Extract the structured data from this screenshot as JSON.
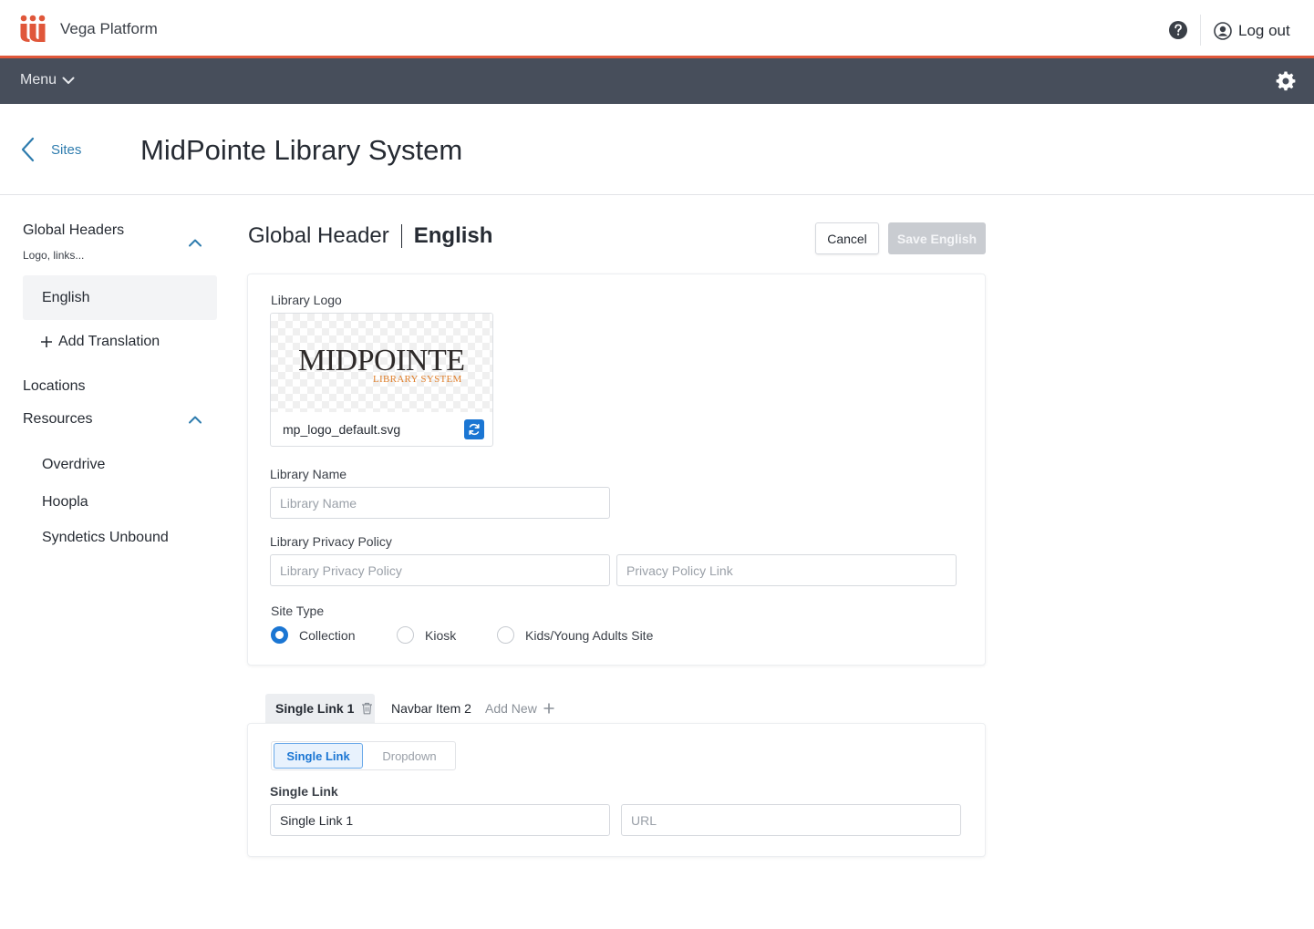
{
  "app": {
    "name": "Vega Platform",
    "logout_label": "Log out",
    "brand_color": "#e0573a"
  },
  "navbar": {
    "menu_label": "Menu"
  },
  "page": {
    "back_label": "Sites",
    "title": "MidPointe Library System"
  },
  "sidebar": {
    "global_headers": {
      "label": "Global Headers",
      "sub": "Logo, links..."
    },
    "active_item": "English",
    "add_translation": "Add Translation",
    "locations": "Locations",
    "resources": {
      "label": "Resources",
      "items": [
        "Overdrive",
        "Hoopla",
        "Syndetics Unbound"
      ]
    }
  },
  "main": {
    "title": "Global Header",
    "language": "English",
    "cancel_label": "Cancel",
    "save_label": "Save English"
  },
  "form": {
    "logo": {
      "label": "Library Logo",
      "wordmark": "MIDPOINTE",
      "wordmark_sub": "LIBRARY SYSTEM",
      "file_name": "mp_logo_default.svg"
    },
    "library_name": {
      "label": "Library Name",
      "placeholder": "Library Name",
      "value": ""
    },
    "privacy": {
      "label": "Library Privacy Policy",
      "name_placeholder": "Library Privacy Policy",
      "link_placeholder": "Privacy Policy Link"
    },
    "site_type": {
      "label": "Site Type",
      "options": [
        "Collection",
        "Kiosk",
        "Kids/Young Adults Site"
      ],
      "selected": "Collection"
    }
  },
  "nav_items": {
    "tabs": [
      "Single Link 1",
      "Navbar Item 2"
    ],
    "active_tab": "Single Link 1",
    "add_new": "Add New",
    "type_options": [
      "Single Link",
      "Dropdown"
    ],
    "selected_type": "Single Link",
    "single_link": {
      "label": "Single Link",
      "value": "Single Link 1",
      "url_placeholder": "URL"
    }
  }
}
